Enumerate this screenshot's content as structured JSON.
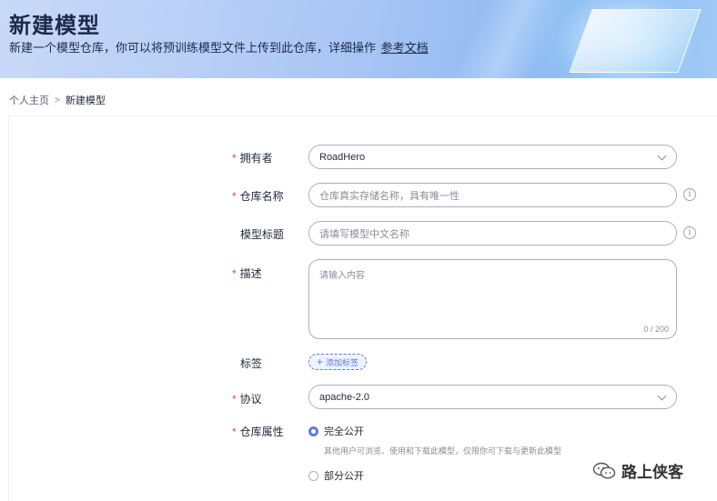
{
  "banner": {
    "title": "新建模型",
    "description": "新建一个模型仓库，你可以将预训练模型文件上传到此仓库，详细操作",
    "doc_link": "参考文档"
  },
  "breadcrumb": {
    "home": "个人主页",
    "current": "新建模型"
  },
  "form": {
    "owner": {
      "label": "拥有者",
      "required": true,
      "value": "RoadHero"
    },
    "repo_name": {
      "label": "仓库名称",
      "required": true,
      "placeholder": "仓库真实存储名称，具有唯一性"
    },
    "model_title": {
      "label": "模型标题",
      "required": false,
      "placeholder": "请填写模型中文名称"
    },
    "description": {
      "label": "描述",
      "required": true,
      "placeholder": "请输入内容",
      "counter": "0 / 200"
    },
    "tags": {
      "label": "标签",
      "add_button": "添加标签"
    },
    "license": {
      "label": "协议",
      "required": true,
      "value": "apache-2.0"
    },
    "visibility": {
      "label": "仓库属性",
      "required": true,
      "options": [
        {
          "label": "完全公开",
          "selected": true,
          "description": "其他用户可浏览、使用和下载此模型，仅限你可下载与更新此模型"
        },
        {
          "label": "部分公开",
          "selected": false
        }
      ]
    }
  },
  "watermark": {
    "text": "路上侠客"
  },
  "colors": {
    "accent": "#5e7ce0",
    "required": "#e8464e",
    "border": "#adb0b8"
  },
  "icons": {
    "info": "info-icon",
    "chevron": "chevron-down-icon",
    "plus": "plus-icon",
    "wechat": "wechat-icon"
  }
}
